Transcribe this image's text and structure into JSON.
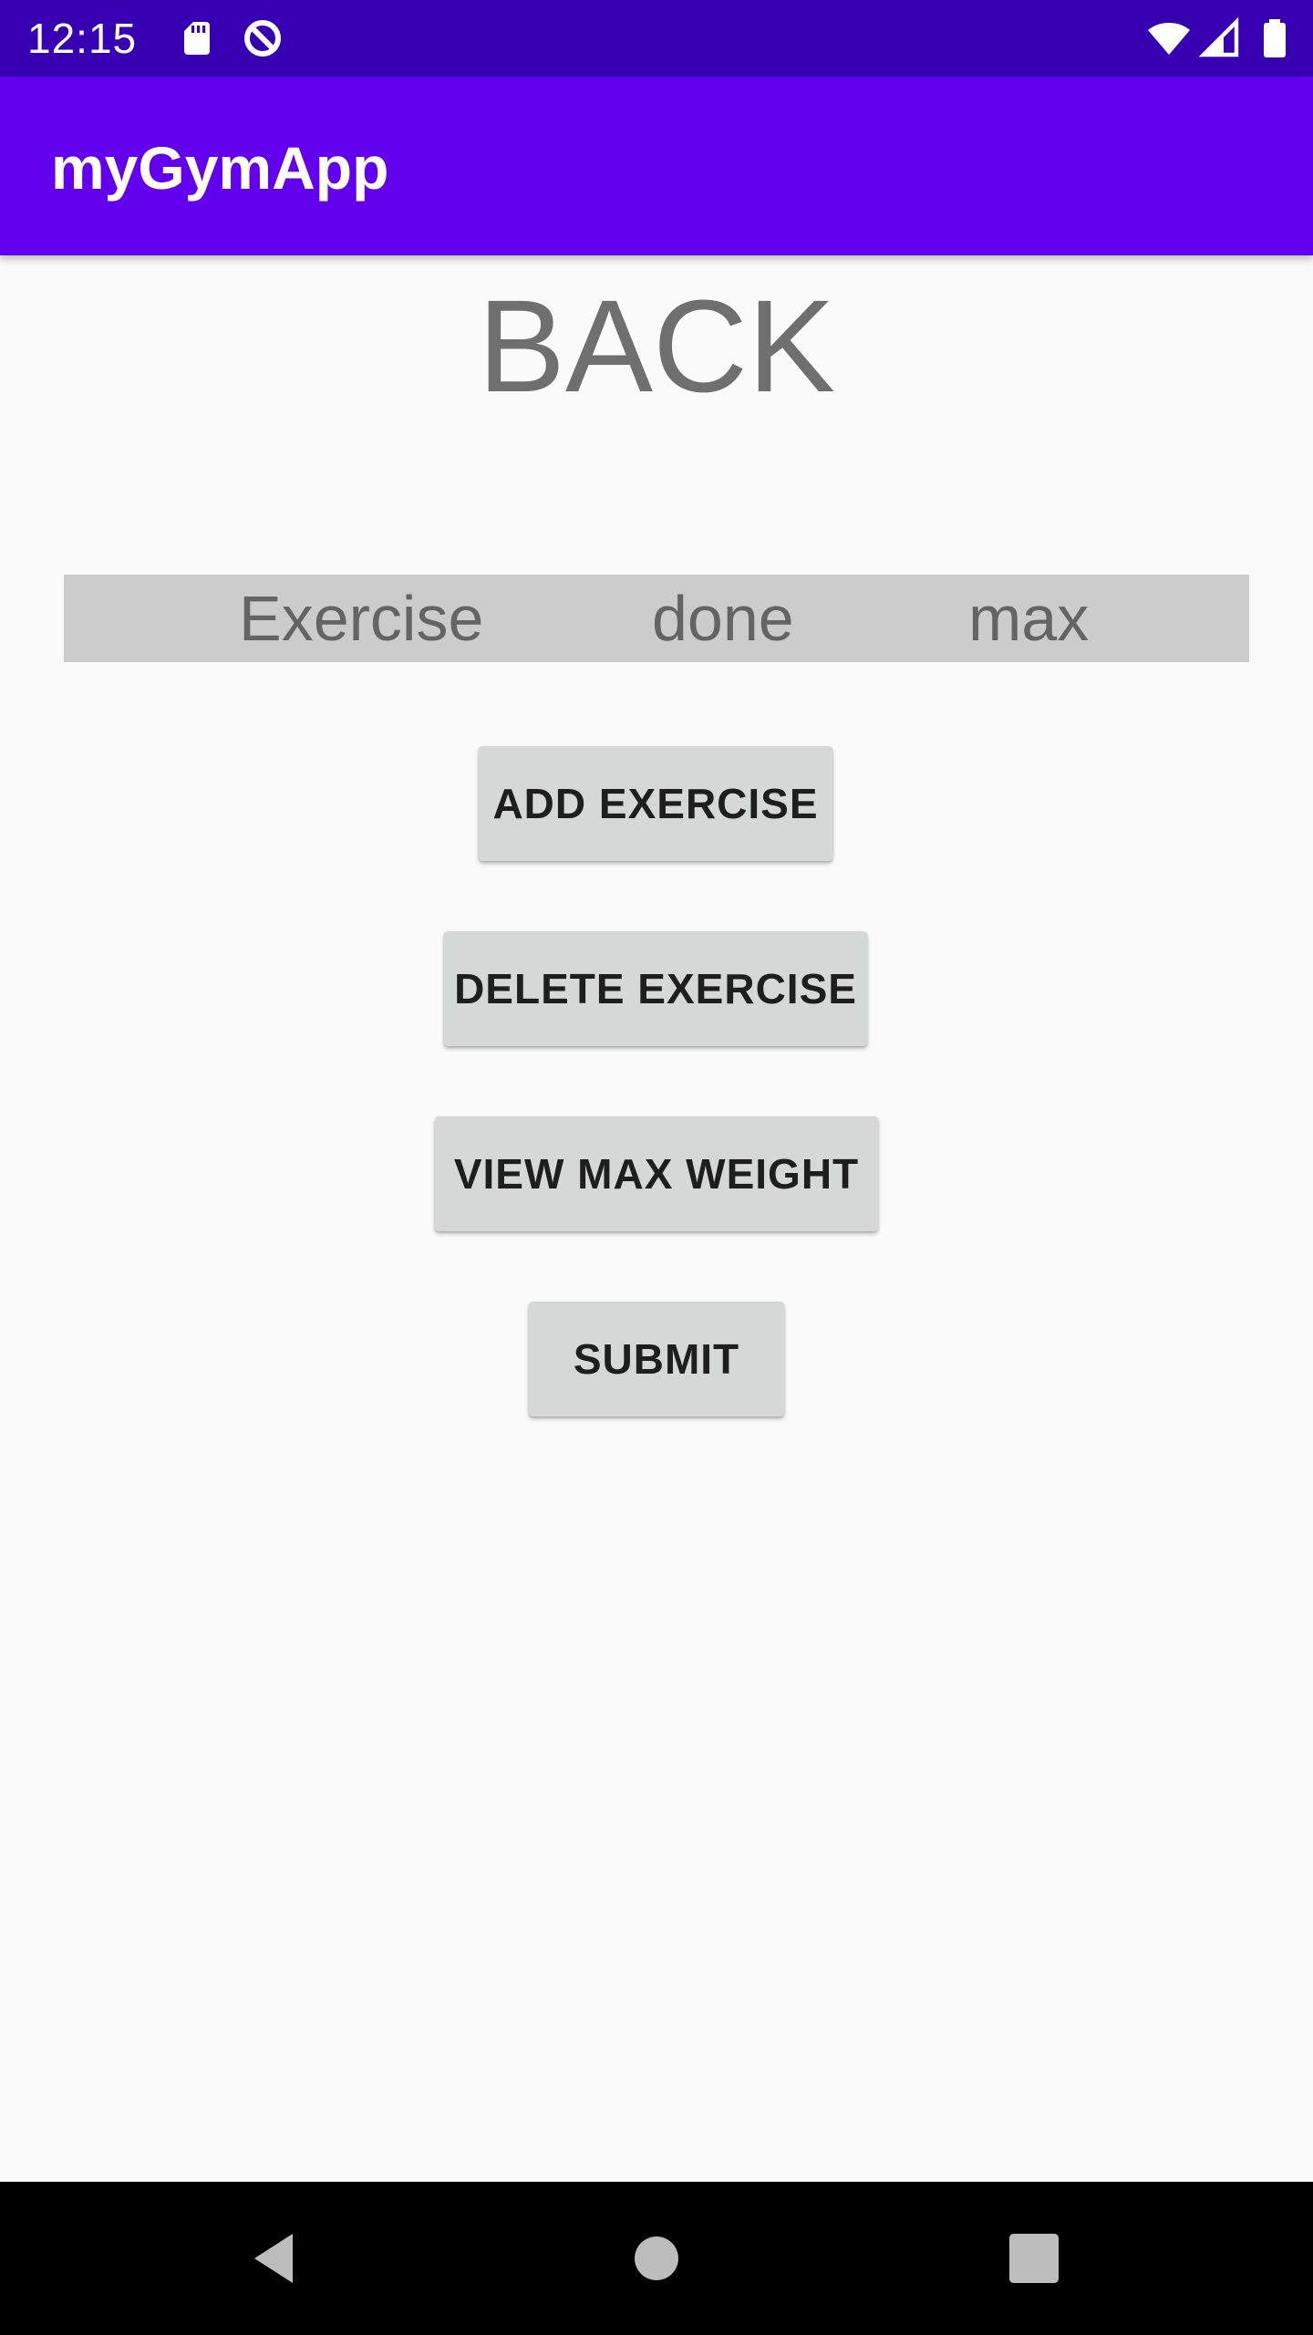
{
  "status_bar": {
    "time": "12:15",
    "icons": [
      "sd-card-icon",
      "data-saver-icon",
      "wifi-icon",
      "signal-icon",
      "battery-icon"
    ],
    "background": "#3700b3"
  },
  "app_bar": {
    "title": "myGymApp",
    "background": "#6200ee"
  },
  "content": {
    "heading": "BACK",
    "table_header": {
      "columns": [
        "Exercise",
        "done",
        "max"
      ]
    },
    "buttons": {
      "add_exercise": "ADD EXERCISE",
      "delete_exercise": "DELETE EXERCISE",
      "view_max_weight": "VIEW MAX WEIGHT",
      "submit": "SUBMIT"
    }
  },
  "nav_bar": {
    "icons": [
      "back-icon",
      "home-icon",
      "recents-icon"
    ]
  }
}
